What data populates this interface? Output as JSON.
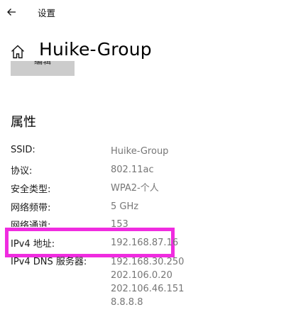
{
  "window": {
    "title": "设置",
    "back_icon": "back-arrow-icon"
  },
  "header": {
    "home_icon": "home-icon",
    "title": "Huike-Group",
    "edit_label": "编辑"
  },
  "properties": {
    "section_title": "属性",
    "rows": [
      {
        "label": "SSID:",
        "value": "Huike-Group"
      },
      {
        "label": "协议:",
        "value": "802.11ac"
      },
      {
        "label": "安全类型:",
        "value": "WPA2-个人"
      },
      {
        "label": "网络频带:",
        "value": "5 GHz"
      },
      {
        "label": "网络通道:",
        "value": "153"
      },
      {
        "label": "IPv4 地址:",
        "value": "192.168.87.16"
      },
      {
        "label": "IPv4 DNS 服务器:",
        "values": [
          "192.168.30.250",
          "202.106.0.20",
          "202.106.46.151",
          "8.8.8.8"
        ]
      }
    ]
  },
  "annotation": {
    "highlight_color": "#f02ce0"
  }
}
